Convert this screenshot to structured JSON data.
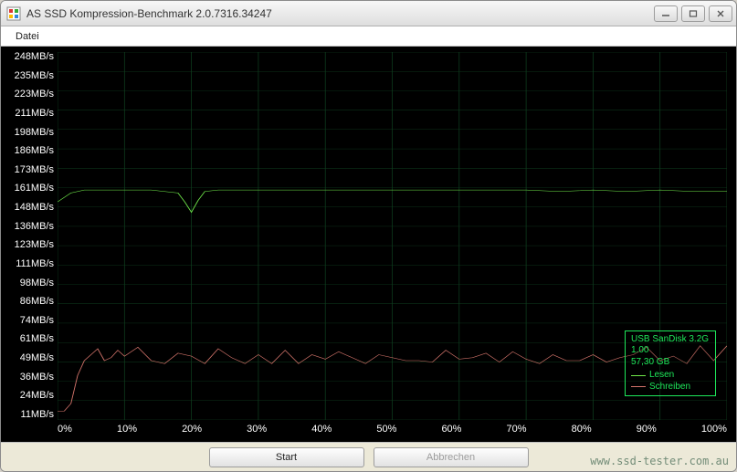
{
  "window": {
    "title": "AS SSD Kompression-Benchmark 2.0.7316.34247"
  },
  "menu": {
    "file": "Datei"
  },
  "buttons": {
    "start": "Start",
    "cancel": "Abbrechen"
  },
  "legend": {
    "device": "USB  SanDisk 3.2G",
    "version": "1.00",
    "capacity": "57,30 GB",
    "read": "Lesen",
    "write": "Schreiben"
  },
  "watermark": "www.ssd-tester.com.au",
  "chart_data": {
    "type": "line",
    "xlabel": "",
    "ylabel": "",
    "x_unit": "%",
    "y_unit": "MB/s",
    "xlim": [
      0,
      100
    ],
    "ylim": [
      0,
      248
    ],
    "x_ticks": [
      "0%",
      "10%",
      "20%",
      "30%",
      "40%",
      "50%",
      "60%",
      "70%",
      "80%",
      "90%",
      "100%"
    ],
    "y_ticks": [
      "248MB/s",
      "235MB/s",
      "223MB/s",
      "211MB/s",
      "198MB/s",
      "186MB/s",
      "173MB/s",
      "161MB/s",
      "148MB/s",
      "136MB/s",
      "123MB/s",
      "111MB/s",
      "98MB/s",
      "86MB/s",
      "74MB/s",
      "61MB/s",
      "49MB/s",
      "36MB/s",
      "24MB/s",
      "11MB/s"
    ],
    "series": [
      {
        "name": "Lesen",
        "color": "#6fe84a",
        "x": [
          0,
          2,
          4,
          6,
          8,
          10,
          12,
          14,
          16,
          18,
          19,
          20,
          21,
          22,
          24,
          26,
          28,
          30,
          35,
          40,
          45,
          50,
          55,
          60,
          65,
          70,
          75,
          80,
          85,
          90,
          95,
          100
        ],
        "values": [
          147,
          153,
          155,
          155,
          155,
          155,
          155,
          155,
          154,
          153,
          147,
          140,
          148,
          154,
          155,
          155,
          155,
          155,
          155,
          155,
          155,
          155,
          155,
          155,
          155,
          155,
          154,
          155,
          154,
          155,
          154,
          154
        ]
      },
      {
        "name": "Schreiben",
        "color": "#d4746b",
        "x": [
          0,
          1,
          2,
          3,
          4,
          5,
          6,
          7,
          8,
          9,
          10,
          12,
          14,
          16,
          18,
          20,
          22,
          24,
          26,
          28,
          30,
          32,
          34,
          36,
          38,
          40,
          42,
          44,
          46,
          48,
          50,
          52,
          54,
          56,
          58,
          60,
          62,
          64,
          66,
          68,
          70,
          72,
          74,
          76,
          78,
          80,
          82,
          84,
          86,
          88,
          90,
          92,
          94,
          96,
          98,
          100
        ],
        "values": [
          6,
          6,
          11,
          30,
          40,
          44,
          48,
          40,
          42,
          47,
          43,
          49,
          40,
          38,
          45,
          43,
          38,
          48,
          42,
          38,
          44,
          38,
          47,
          38,
          44,
          41,
          46,
          42,
          38,
          44,
          42,
          40,
          40,
          39,
          47,
          41,
          42,
          45,
          39,
          46,
          41,
          38,
          44,
          40,
          40,
          44,
          39,
          42,
          44,
          49,
          40,
          43,
          38,
          50,
          40,
          50
        ]
      }
    ]
  }
}
